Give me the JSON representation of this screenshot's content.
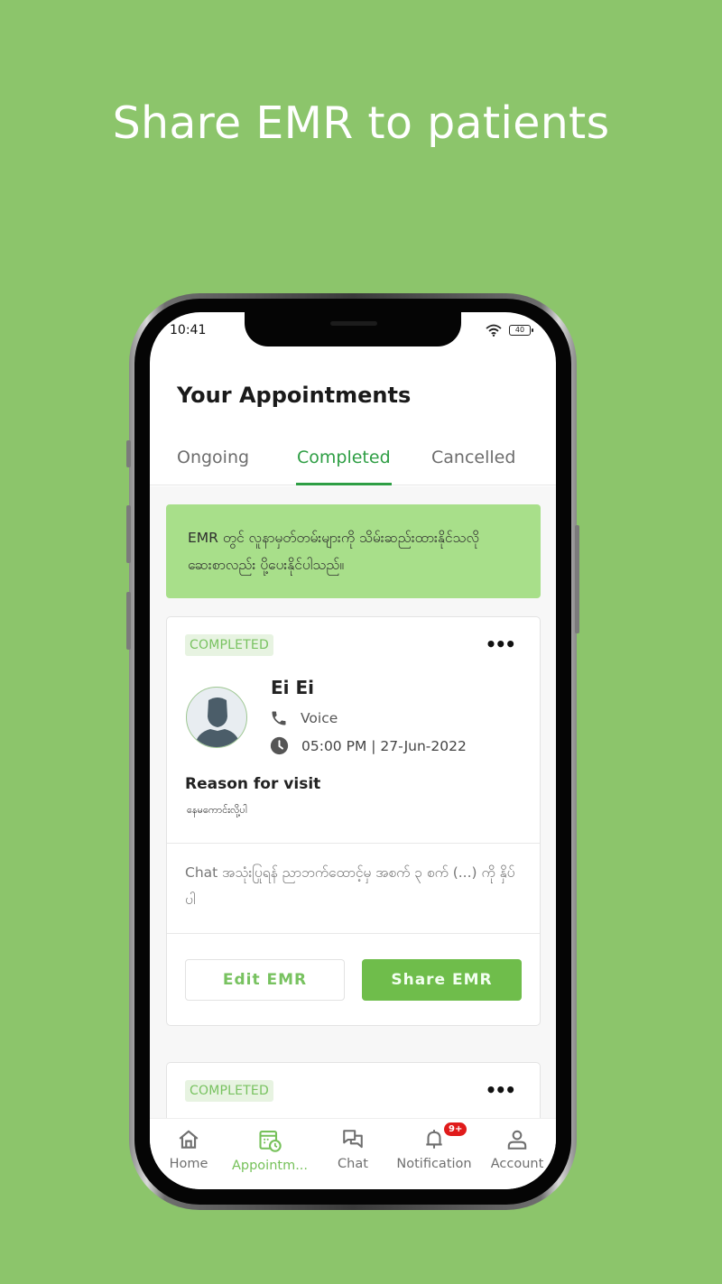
{
  "headline": "Share EMR to patients",
  "status_bar": {
    "time": "10:41",
    "battery": "40"
  },
  "page_title": "Your Appointments",
  "tabs": [
    {
      "label": "Ongoing"
    },
    {
      "label": "Completed",
      "active": true
    },
    {
      "label": "Cancelled"
    }
  ],
  "banner": {
    "text": "EMR တွင် လူနာမှတ်တမ်းများကို သိမ်းဆည်းထားနိုင်သလို ဆေးစာလည်း ပို့ပေးနိုင်ပါသည်။"
  },
  "appointments": [
    {
      "status": "COMPLETED",
      "more_label": "•••",
      "patient_name": "Ei Ei",
      "call_type": "Voice",
      "datetime": "05:00 PM | 27-Jun-2022",
      "reason_label": "Reason for visit",
      "reason_value": "နေမကောင်းလို့ပါ",
      "chat_note": "Chat အသုံးပြုရန် ညာဘက်ထောင့်မှ အစက် ၃ စက် (...) ကို နှိပ်ပါ",
      "edit_label": "Edit EMR",
      "share_label": "Share EMR"
    },
    {
      "status": "COMPLETED",
      "more_label": "•••"
    }
  ],
  "bottom_nav": [
    {
      "label": "Home",
      "icon": "home-icon"
    },
    {
      "label": "Appointm...",
      "icon": "calendar-clock-icon",
      "active": true
    },
    {
      "label": "Chat",
      "icon": "chat-icon"
    },
    {
      "label": "Notification",
      "icon": "bell-icon",
      "badge": "9+"
    },
    {
      "label": "Account",
      "icon": "user-icon"
    }
  ],
  "colors": {
    "background": "#8cc56b",
    "accent": "#2e9e44",
    "primary_button": "#6fbd4b",
    "banner": "#a8df8a",
    "badge_bg": "#e7f3e1",
    "notification_badge": "#e01b1b"
  }
}
